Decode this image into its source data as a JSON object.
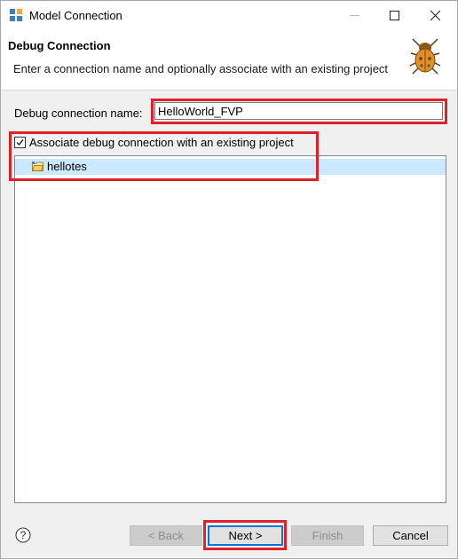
{
  "window": {
    "title": "Model Connection",
    "icon": "model-connection-icon",
    "controls": [
      "minimize-icon",
      "maximize-icon",
      "close-icon"
    ]
  },
  "header": {
    "title": "Debug Connection",
    "description": "Enter a connection name and optionally associate with an existing project",
    "icon": "bug-icon"
  },
  "form": {
    "name_label": "Debug connection name:",
    "name_value": "HelloWorld_FVP",
    "associate_label": "Associate debug connection with an existing project",
    "associate_checked": true
  },
  "projects": [
    {
      "name": "hellotes",
      "selected": true,
      "icon": "project-folder-icon"
    }
  ],
  "footer": {
    "help_icon": "help-icon",
    "back_label": "< Back",
    "next_label": "Next >",
    "finish_label": "Finish",
    "cancel_label": "Cancel"
  },
  "colors": {
    "highlight_box": "#e0202a",
    "selection": "#cce8ff",
    "default_button_border": "#0078d7"
  }
}
